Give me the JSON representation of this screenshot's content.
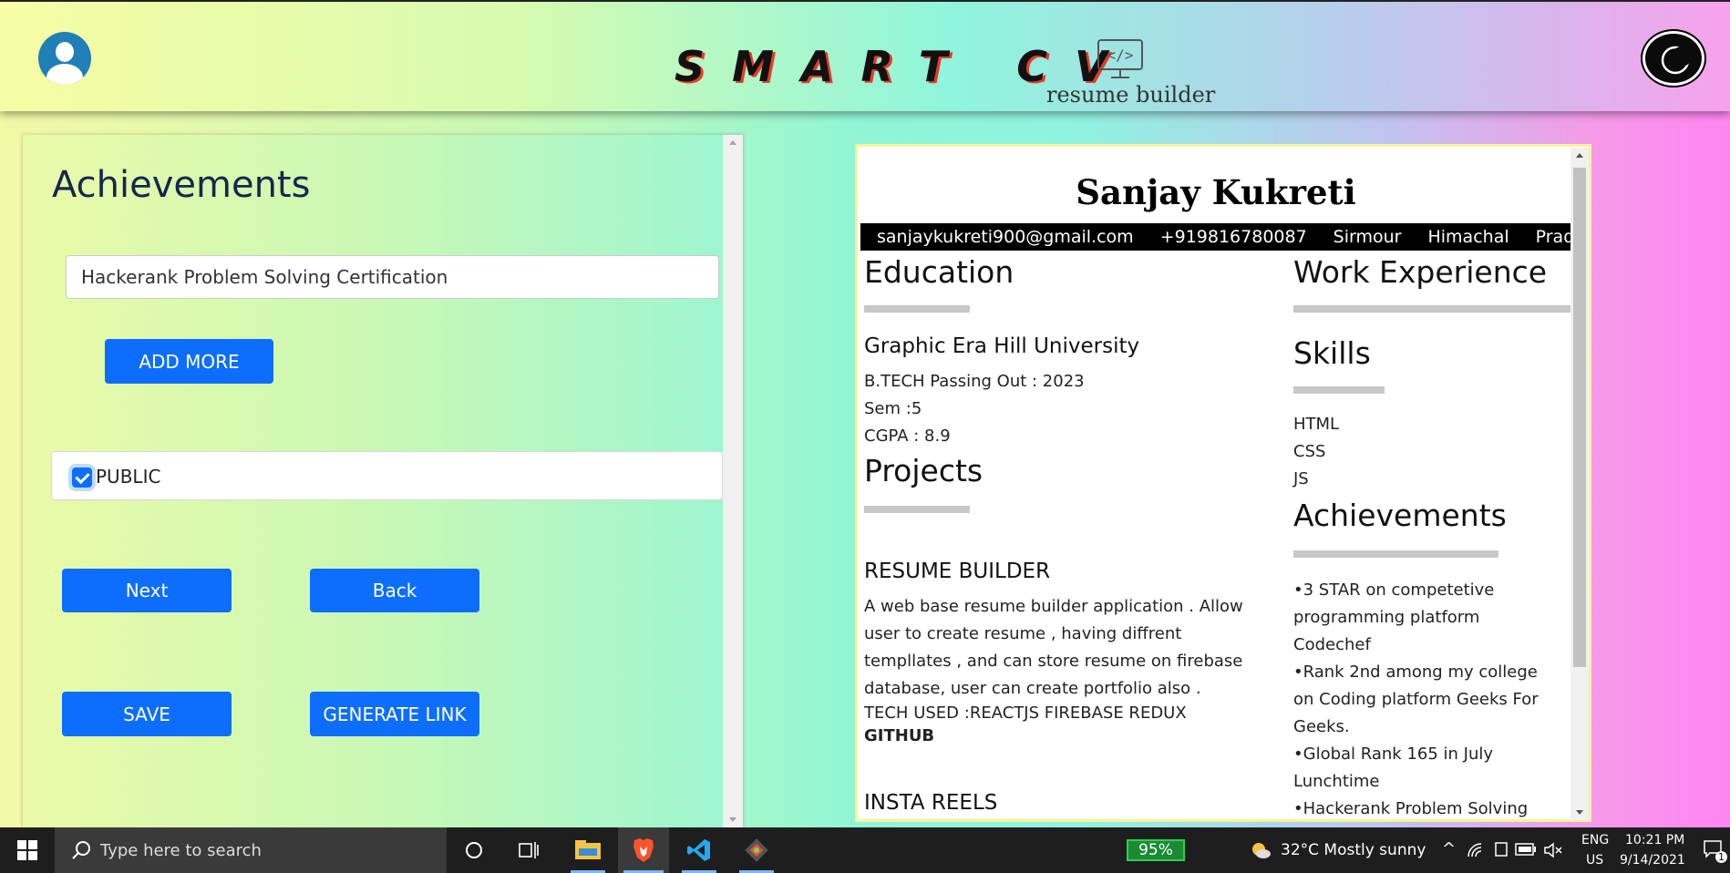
{
  "header": {
    "brand": "SMART CV",
    "logo_subtitle": "resume builder"
  },
  "form": {
    "section_title": "Achievements",
    "achievement_value": "Hackerank Problem Solving Certification",
    "add_more_label": "ADD MORE",
    "public_label": "PUBLIC",
    "public_checked": true,
    "next_label": "Next",
    "back_label": "Back",
    "save_label": "SAVE",
    "generate_label": "GENERATE LINK"
  },
  "resume": {
    "name": "Sanjay Kukreti",
    "contact": [
      "sanjaykukreti900@gmail.com",
      "+919816780087",
      "Sirmour",
      "Himachal",
      "Pradesh"
    ],
    "education": {
      "heading": "Education",
      "school": "Graphic Era Hill University",
      "lines": [
        "B.TECH Passing Out : 2023",
        "Sem :5",
        "CGPA : 8.9"
      ]
    },
    "projects": {
      "heading": "Projects",
      "items": [
        {
          "title": "RESUME BUILDER",
          "desc_lines": [
            "A web base resume builder application . Allow",
            "user to create resume , having diffrent",
            "templlates , and can store resume on firebase",
            "database, user can create portfolio also .",
            "TECH USED :REACTJS FIREBASE REDUX"
          ],
          "link": "GITHUB"
        },
        {
          "title": "INSTA REELS"
        }
      ]
    },
    "work": {
      "heading": "Work Experience"
    },
    "skills": {
      "heading": "Skills",
      "items": [
        "HTML",
        "CSS",
        "JS"
      ]
    },
    "achievements": {
      "heading": "Achievements",
      "lines": [
        "•3 STAR on competetive",
        "programming platform",
        "Codechef",
        "•Rank 2nd among my college",
        "on Coding platform Geeks For",
        "Geeks.",
        "•Global Rank 165 in July",
        "Lunchtime",
        "•Hackerank Problem Solving"
      ]
    }
  },
  "taskbar": {
    "search_placeholder": "Type here to search",
    "battery": "95%",
    "weather": "32°C  Mostly sunny",
    "lang1": "ENG",
    "lang2": "US",
    "time": "10:21 PM",
    "date": "9/14/2021",
    "notif_count": "1"
  },
  "colors": {
    "primary_button": "#0d6efd",
    "title_navy": "#14274e"
  }
}
